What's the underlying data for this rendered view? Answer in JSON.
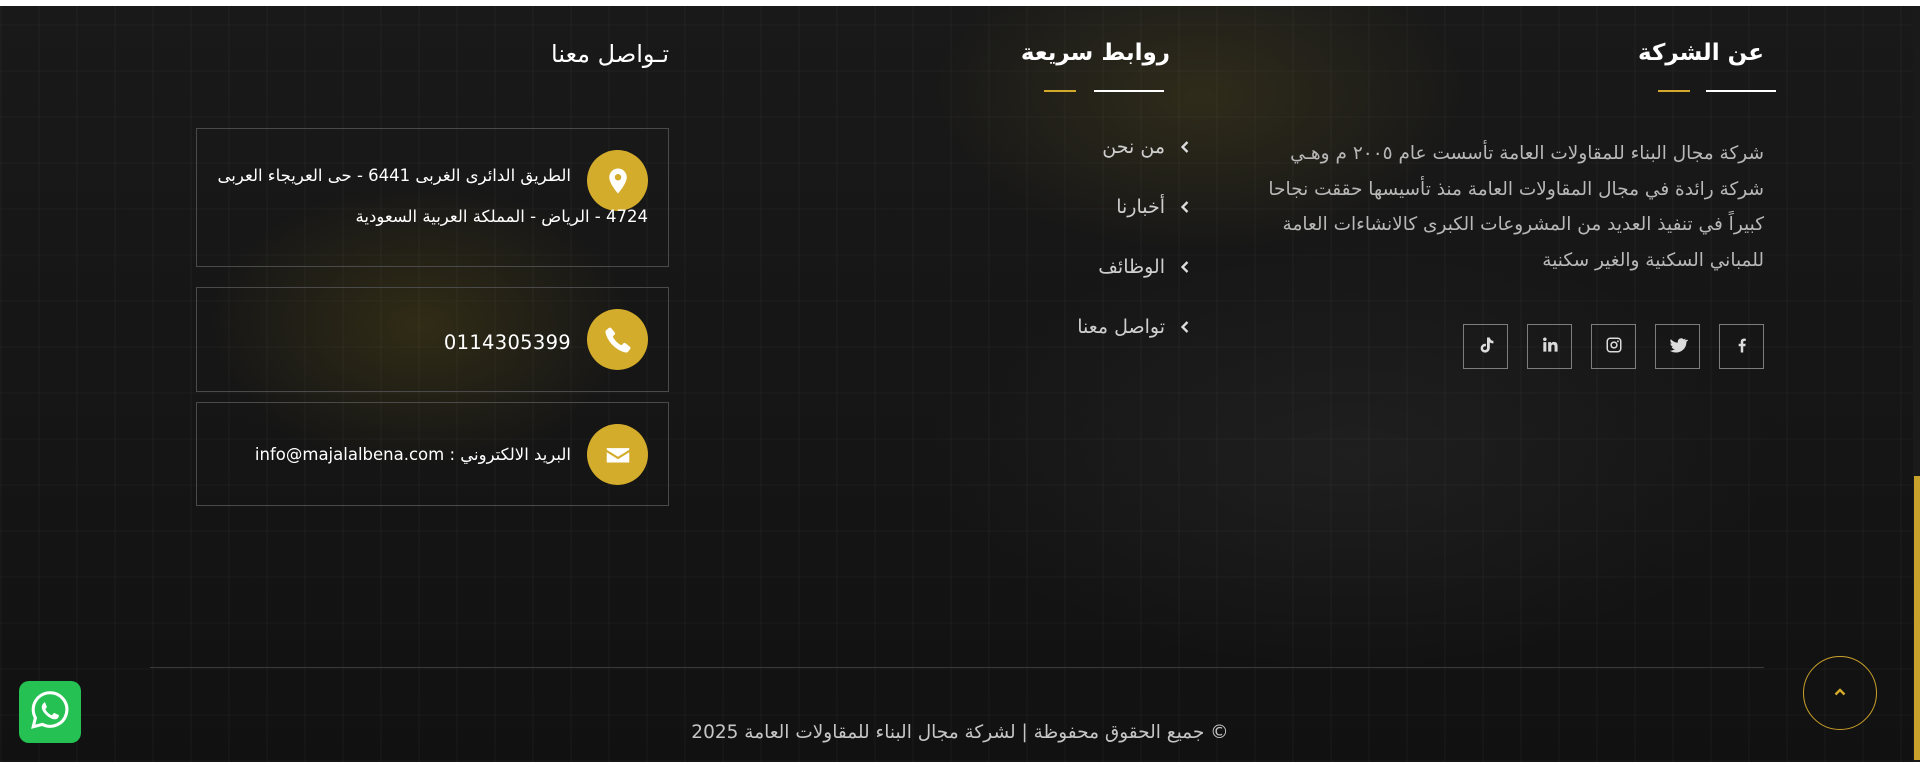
{
  "about": {
    "title": "عن الشركة",
    "text": "شركة مجال البناء للمقاولات العامة تأسست عام ٢٠٠٥ م وهـي شركة رائدة في مجال المقاولات العامة منذ تأسيسها حققت نجاحا كبيراً في تنفيذ العديد من المشروعات الكبرى كالانشاءات العامة للمباني السكنية والغير سكنية",
    "social": [
      {
        "name": "facebook-icon"
      },
      {
        "name": "twitter-icon"
      },
      {
        "name": "instagram-icon"
      },
      {
        "name": "linkedin-icon"
      },
      {
        "name": "tiktok-icon"
      }
    ]
  },
  "quick_links": {
    "title": "روابط سريعة",
    "items": [
      {
        "label": "من نحن"
      },
      {
        "label": "أخبارنا"
      },
      {
        "label": "الوظائف"
      },
      {
        "label": "تواصل معنا"
      }
    ]
  },
  "contact": {
    "title": "تـواصل معنا",
    "address_line1": "الطريق الدائرى الغربى 6441 - حى العريجاء العربى",
    "address_line2": "4724 - الرياض - المملكة العربية السعودية",
    "phone": "0114305399",
    "email": "البريد الالكتروني : info@majalalbena.com",
    "icons": {
      "address": "location-pin-icon",
      "phone": "phone-icon",
      "email": "envelope-icon"
    }
  },
  "footer": {
    "copyright": "© جميع الحقوق محفوظة | لشركة مجال البناء للمقاولات العامة 2025"
  },
  "colors": {
    "accent": "#d4ac2b",
    "background": "#161616",
    "whatsapp": "#25c153"
  }
}
